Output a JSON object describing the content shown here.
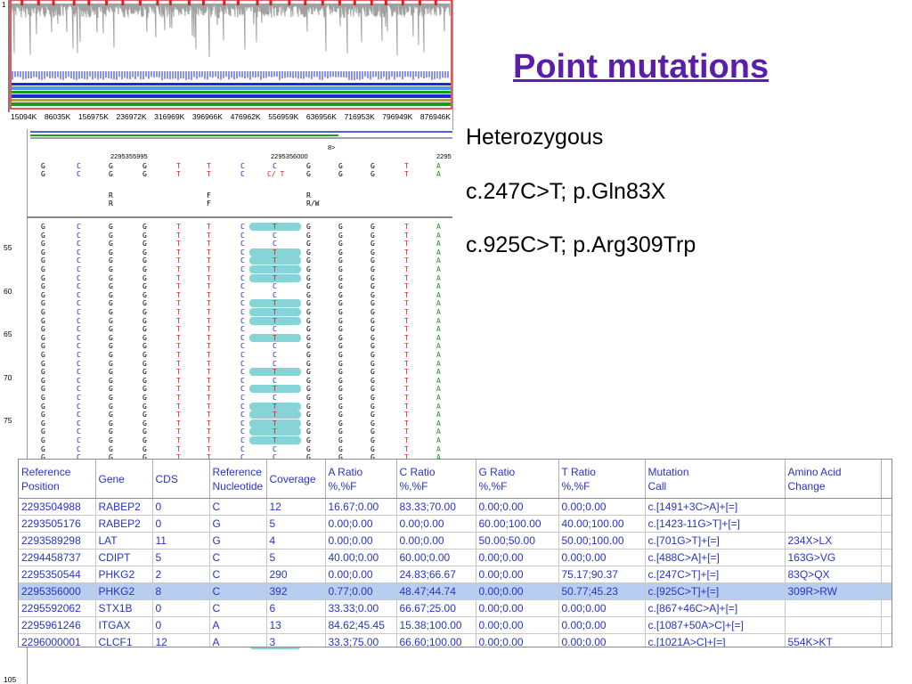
{
  "overview": {
    "ticks": [
      "15094K",
      "86035K",
      "156975K",
      "236972K",
      "316969K",
      "396966K",
      "476962K",
      "556959K",
      "636956K",
      "716953K",
      "796949K",
      "876946K"
    ],
    "colors": {
      "coverage": "#a0a0a0",
      "frame": "#e02020",
      "blue": "#1a2ad6",
      "green": "#1d9a1d"
    }
  },
  "viewer": {
    "ref_positions": [
      "2295355995",
      "2295356000",
      "2295"
    ],
    "marker": "8>",
    "ref_row1": [
      "G",
      "C",
      "G",
      "G",
      "T",
      "T",
      "C",
      "C",
      "G",
      "G",
      "G",
      "T",
      "A"
    ],
    "ref_row2": [
      "G",
      "C",
      "G",
      "G",
      "T",
      "T",
      "C",
      "C/ T",
      "G",
      "G",
      "G",
      "T",
      "A"
    ],
    "ambig_row1": [
      "",
      "",
      "R",
      "",
      "",
      "F",
      "",
      "",
      "R",
      "",
      "",
      "",
      ""
    ],
    "ambig_row2": [
      "",
      "",
      "R",
      "",
      "",
      "F",
      "",
      "",
      "R/W",
      "",
      "",
      "",
      ""
    ],
    "row_numbers": [
      "55",
      "60",
      "65",
      "70",
      "75",
      "105"
    ],
    "base_colors": {
      "G": "#000000",
      "C": "#1a2ad6",
      "T": "#e02020",
      "A": "#1d9a1d"
    }
  },
  "title": "Point mutations",
  "mutations": [
    "Heterozygous",
    "c.247C>T; p.Gln83X",
    "c.925C>T; p.Arg309Trp"
  ],
  "table": {
    "headers": [
      [
        "Reference",
        "Position"
      ],
      [
        "Gene"
      ],
      [
        "CDS"
      ],
      [
        "Reference",
        "Nucleotide"
      ],
      [
        "Coverage"
      ],
      [
        "A Ratio",
        "%,%F"
      ],
      [
        "C Ratio",
        "%,%F"
      ],
      [
        "G Ratio",
        "%,%F"
      ],
      [
        "T Ratio",
        "%,%F"
      ],
      [
        "Mutation",
        "Call"
      ],
      [
        "Amino Acid",
        "Change"
      ]
    ],
    "rows": [
      [
        "2293504988",
        "RABEP2",
        "0",
        "C",
        "12",
        "16.67;0.00",
        "83.33;70.00",
        "0.00;0.00",
        "0.00;0.00",
        "c.[1491+3C>A]+[=]",
        ""
      ],
      [
        "2293505176",
        "RABEP2",
        "0",
        "G",
        "5",
        "0.00;0.00",
        "0.00;0.00",
        "60.00;100.00",
        "40.00;100.00",
        "c.[1423-11G>T]+[=]",
        ""
      ],
      [
        "2293589298",
        "LAT",
        "11",
        "G",
        "4",
        "0.00;0.00",
        "0.00;0.00",
        "50.00;50.00",
        "50.00;100.00",
        "c.[701G>T]+[=]",
        "234X>LX"
      ],
      [
        "2294458737",
        "CDIPT",
        "5",
        "C",
        "5",
        "40.00;0.00",
        "60.00;0.00",
        "0.00;0.00",
        "0.00;0.00",
        "c.[488C>A]+[=]",
        "163G>VG"
      ],
      [
        "2295350544",
        "PHKG2",
        "2",
        "C",
        "290",
        "0.00;0.00",
        "24.83;66.67",
        "0.00;0.00",
        "75.17;90.37",
        "c.[247C>T]+[=]",
        "83Q>QX"
      ],
      [
        "2295356000",
        "PHKG2",
        "8",
        "C",
        "392",
        "0.77;0.00",
        "48.47;44.74",
        "0.00;0.00",
        "50.77;45.23",
        "c.[925C>T]+[=]",
        "309R>RW"
      ],
      [
        "2295592062",
        "STX1B",
        "0",
        "C",
        "6",
        "33.33;0.00",
        "66.67;25.00",
        "0.00;0.00",
        "0.00;0.00",
        "c.[867+46C>A]+[=]",
        ""
      ],
      [
        "2295961246",
        "ITGAX",
        "0",
        "A",
        "13",
        "84.62;45.45",
        "15.38;100.00",
        "0.00;0.00",
        "0.00;0.00",
        "c.[1087+50A>C]+[=]",
        ""
      ],
      [
        "2296000001",
        "CLCF1",
        "12",
        "A",
        "3",
        "33.3;75.00",
        "66.60;100.00",
        "0.00;0.00",
        "0.00;0.00",
        "c.[1021A>C]+[=]",
        "554K>KT"
      ]
    ],
    "selected_row": 5
  }
}
